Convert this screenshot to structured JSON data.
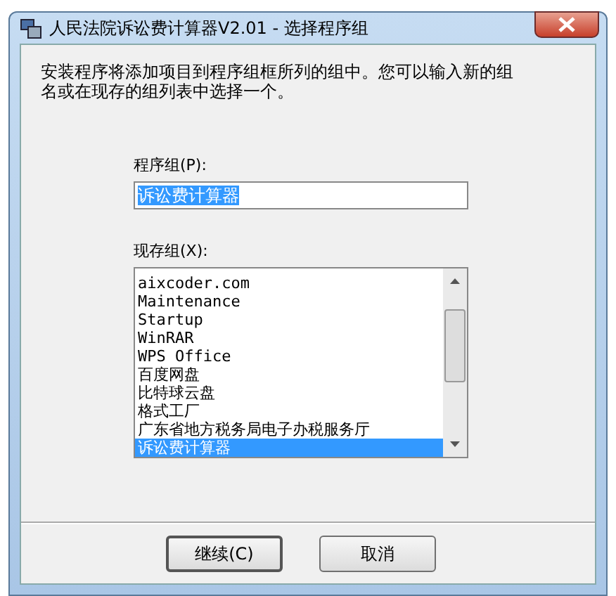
{
  "window": {
    "title": "人民法院诉讼费计算器V2.01 - 选择程序组"
  },
  "instructions": "安装程序将添加项目到程序组框所列的组中。您可以输入新的组名或在现存的组列表中选择一个。",
  "program_group": {
    "label": "程序组(P):",
    "value": "诉讼费计算器"
  },
  "existing_groups": {
    "label": "现存组(X):",
    "items": [
      {
        "text": "aixcoder.com",
        "selected": false
      },
      {
        "text": "Maintenance",
        "selected": false
      },
      {
        "text": "Startup",
        "selected": false
      },
      {
        "text": "WinRAR",
        "selected": false
      },
      {
        "text": "WPS Office",
        "selected": false
      },
      {
        "text": "百度网盘",
        "selected": false
      },
      {
        "text": "比特球云盘",
        "selected": false
      },
      {
        "text": "格式工厂",
        "selected": false
      },
      {
        "text": "广东省地方税务局电子办税服务厅",
        "selected": false
      },
      {
        "text": "诉讼费计算器",
        "selected": true
      }
    ]
  },
  "buttons": [
    {
      "label": "继续(C)",
      "default": true
    },
    {
      "label": "取消",
      "default": false
    }
  ]
}
